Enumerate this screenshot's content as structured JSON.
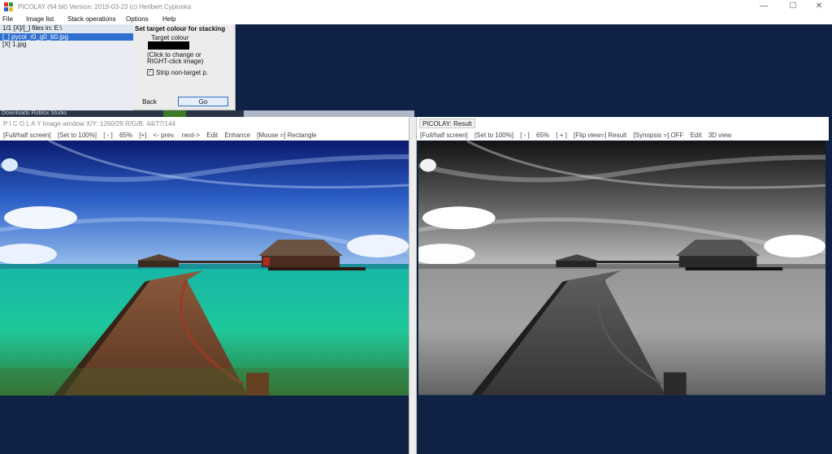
{
  "window": {
    "title": "PICOLAY  (64 bit) Version: 2019-03-23  (c) Heribert Cypionka",
    "controls": {
      "minimize": "—",
      "maximize": "☐",
      "close": "✕"
    }
  },
  "menu": [
    "File",
    "Image list",
    "Stack operations",
    "Options",
    "Help"
  ],
  "image_list": {
    "header": "1/1 [X]/[_] files in: E:\\",
    "files": [
      "[_] pycol_r0_g0_b0.jpg",
      "[X] 1.jpg"
    ]
  },
  "stacking_panel": {
    "title": "Set target colour for stacking",
    "target_label": "Target colour",
    "target_color": "#000000",
    "hint_line1": "(Click to change or",
    "hint_line2": "RIGHT-click image)",
    "strip_label": "Strip non-target p.",
    "strip_checked": true,
    "back_label": "Back",
    "go_label": "Go"
  },
  "background_window": {
    "text": "Downloads    Roblox Studio"
  },
  "image_window": {
    "title": "P I C O L A Y  Image window X/Y: 1260/29 R/G/B: 44/77/144",
    "toolbar": [
      "[Full/half screen]",
      "[Set to 100%]",
      "[ - ]",
      "65%",
      "[+]",
      "<- prev.",
      "next->",
      "Edit",
      "Enhance",
      "[Mouse =] Rectangle"
    ]
  },
  "result_window": {
    "tab": "PICOLAY: Result",
    "toolbar": [
      "[Full/half screen]",
      "[Set to 100%]",
      "[ - ]",
      "65%",
      "[ + ]",
      "[Flip view=] Result",
      "[Synopsis =] OFF",
      "Edit",
      "3D view"
    ]
  },
  "colors": {
    "desktop": "#0f2145",
    "selection": "#2e6fd0",
    "accent": "#2e6fd0"
  }
}
